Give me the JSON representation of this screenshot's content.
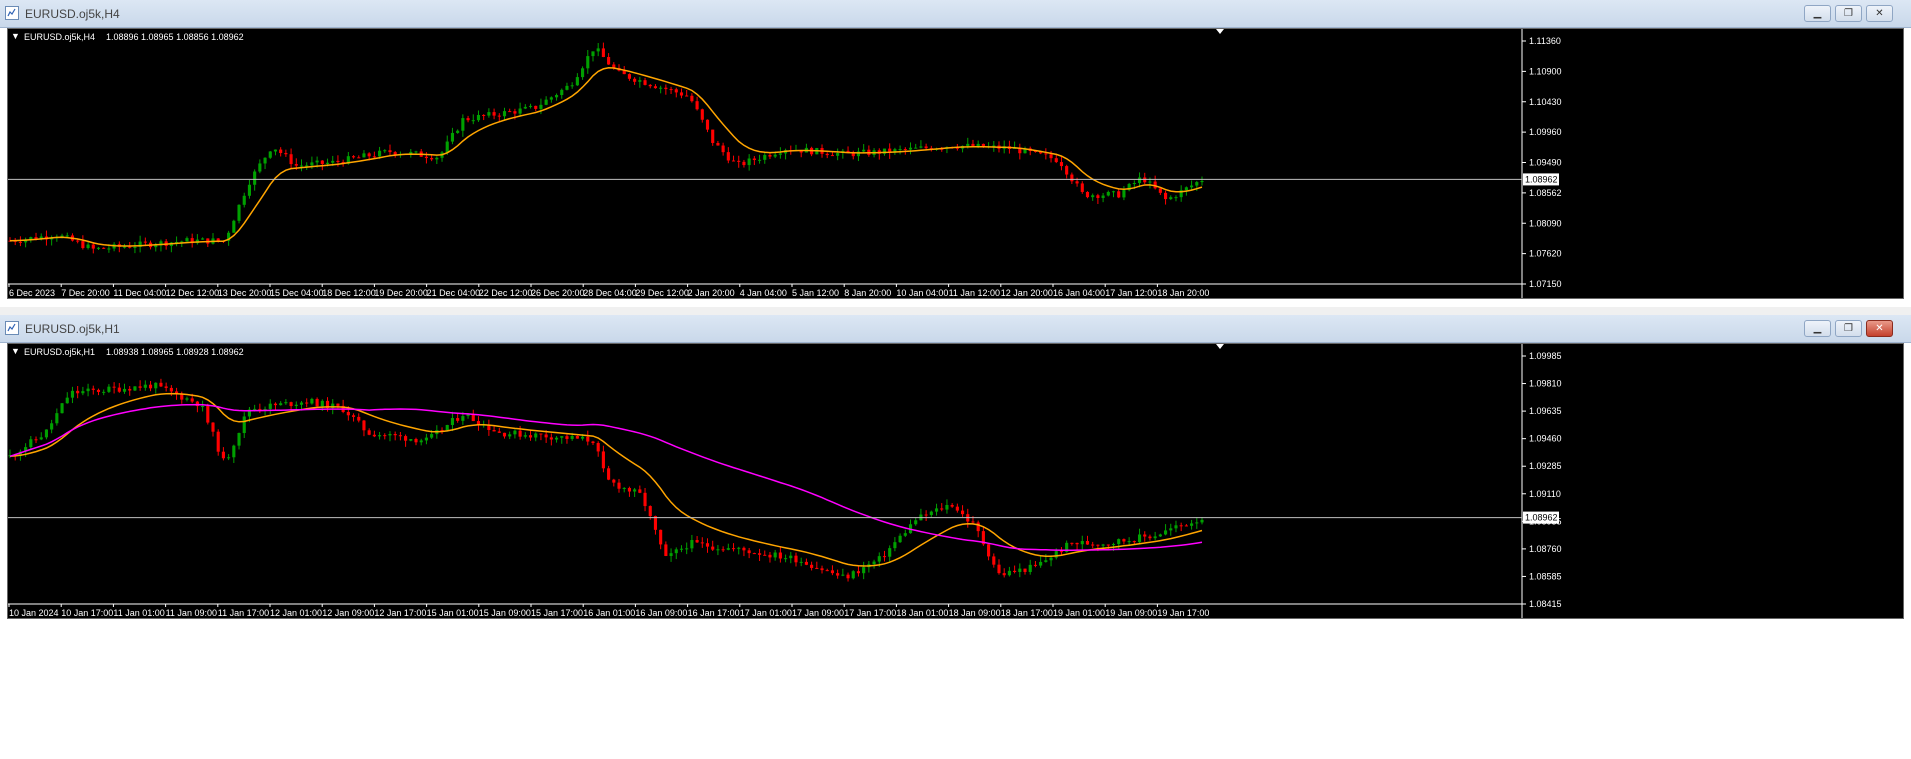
{
  "windows": [
    {
      "title": "EURUSD.oj5k,H4",
      "info": {
        "symbol": "EURUSD.oj5k,H4",
        "ohlc": "1.08896 1.08965 1.08856 1.08962"
      },
      "price_axis": [
        "1.11360",
        "1.10900",
        "1.10430",
        "1.09960",
        "1.09490",
        "1.08562",
        "1.08090",
        "1.07620",
        "1.07150"
      ],
      "price_range": [
        1.0715,
        1.1136
      ],
      "current_price": "1.08962",
      "current_price_value": 1.08962,
      "time_axis": [
        "6 Dec 2023",
        "7 Dec 20:00",
        "11 Dec 04:00",
        "12 Dec 12:00",
        "13 Dec 20:00",
        "15 Dec 04:00",
        "18 Dec 12:00",
        "19 Dec 20:00",
        "21 Dec 04:00",
        "22 Dec 12:00",
        "26 Dec 20:00",
        "28 Dec 04:00",
        "29 Dec 12:00",
        "2 Jan 20:00",
        "4 Jan 04:00",
        "5 Jan 12:00",
        "8 Jan 20:00",
        "10 Jan 04:00",
        "11 Jan 12:00",
        "12 Jan 20:00",
        "16 Jan 04:00",
        "17 Jan 12:00",
        "18 Jan 20:00"
      ],
      "colors": {
        "bull": "#00a000",
        "bear": "#ff0000",
        "ma_orange": "#ffa500",
        "background": "#000000",
        "grid_text": "#ffffff"
      },
      "buttons": [
        "minimize",
        "maximize",
        "close"
      ]
    },
    {
      "title": "EURUSD.oj5k,H1",
      "info": {
        "symbol": "EURUSD.oj5k,H1",
        "ohlc": "1.08938 1.08965 1.08928 1.08962"
      },
      "price_axis": [
        "1.09985",
        "1.09810",
        "1.09635",
        "1.09460",
        "1.09285",
        "1.09110",
        "1.08935",
        "1.08760",
        "1.08585",
        "1.08415"
      ],
      "price_range": [
        1.08415,
        1.09985
      ],
      "current_price": "1.08962",
      "current_price_value": 1.08962,
      "time_axis": [
        "10 Jan 2024",
        "10 Jan 17:00",
        "11 Jan 01:00",
        "11 Jan 09:00",
        "11 Jan 17:00",
        "12 Jan 01:00",
        "12 Jan 09:00",
        "12 Jan 17:00",
        "15 Jan 01:00",
        "15 Jan 09:00",
        "15 Jan 17:00",
        "16 Jan 01:00",
        "16 Jan 09:00",
        "16 Jan 17:00",
        "17 Jan 01:00",
        "17 Jan 09:00",
        "17 Jan 17:00",
        "18 Jan 01:00",
        "18 Jan 09:00",
        "18 Jan 17:00",
        "19 Jan 01:00",
        "19 Jan 09:00",
        "19 Jan 17:00"
      ],
      "colors": {
        "bull": "#00a000",
        "bear": "#ff0000",
        "ma_orange": "#ffa500",
        "ma_magenta": "#ff00ff",
        "background": "#000000",
        "grid_text": "#ffffff"
      },
      "buttons": [
        "minimize",
        "maximize",
        "close"
      ]
    }
  ]
}
